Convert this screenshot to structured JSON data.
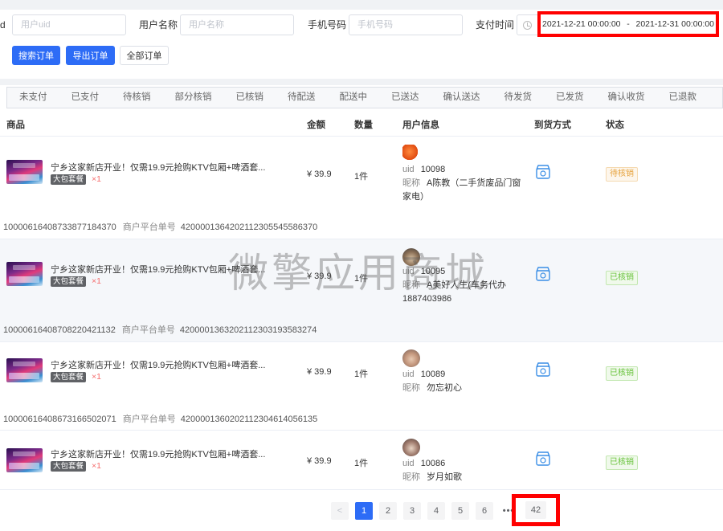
{
  "filters": {
    "uid": {
      "label": "d",
      "placeholder": "用户uid"
    },
    "username": {
      "label": "用户名称",
      "placeholder": "用户名称"
    },
    "phone": {
      "label": "手机号码",
      "placeholder": "手机号码"
    },
    "paytime": {
      "label": "支付时间",
      "start": "2021-12-21 00:00:00",
      "separator": "-",
      "end": "2021-12-31 00:00:00"
    }
  },
  "buttons": {
    "search": "搜索订单",
    "export": "导出订单",
    "all": "全部订单"
  },
  "tabs": [
    "未支付",
    "已支付",
    "待核销",
    "部分核销",
    "已核销",
    "待配送",
    "配送中",
    "已送达",
    "确认送达",
    "待发货",
    "已发货",
    "确认收货",
    "已退款"
  ],
  "columns": {
    "product": "商品",
    "amount": "金额",
    "qty": "数量",
    "user": "用户信息",
    "delivery": "到货方式",
    "status": "状态"
  },
  "orders": [
    {
      "product": "宁乡这家新店开业！仅需19.9元抢购KTV包厢+啤酒套...",
      "tag": "大包套餐",
      "qty_mark": "×1",
      "amount": "¥ 39.9",
      "count": "1件",
      "uid_label": "uid",
      "uid": "10098",
      "nick_label": "昵称",
      "nickname": "A陈教（二手货废品门窗家电）",
      "status": "待核销",
      "order_no": "10000616408733877184370",
      "platform_label": "商户平台单号",
      "platform_no": "4200001364202112305545586370"
    },
    {
      "product": "宁乡这家新店开业！仅需19.9元抢购KTV包厢+啤酒套...",
      "tag": "大包套餐",
      "qty_mark": "×1",
      "amount": "¥ 39.9",
      "count": "1件",
      "uid_label": "uid",
      "uid": "10095",
      "nick_label": "昵称",
      "nickname": "A美好人生(车务代办1887403986",
      "status": "已核销",
      "order_no": "10000616408708220421132",
      "platform_label": "商户平台单号",
      "platform_no": "4200001363202112303193583274"
    },
    {
      "product": "宁乡这家新店开业！仅需19.9元抢购KTV包厢+啤酒套...",
      "tag": "大包套餐",
      "qty_mark": "×1",
      "amount": "¥ 39.9",
      "count": "1件",
      "uid_label": "uid",
      "uid": "10089",
      "nick_label": "昵称",
      "nickname": "勿忘初心",
      "status": "已核销",
      "order_no": "10000616408673166502071",
      "platform_label": "商户平台单号",
      "platform_no": "4200001360202112304614056135"
    },
    {
      "product": "宁乡这家新店开业！仅需19.9元抢购KTV包厢+啤酒套...",
      "tag": "大包套餐",
      "qty_mark": "×1",
      "amount": "¥ 39.9",
      "count": "1件",
      "uid_label": "uid",
      "uid": "10086",
      "nick_label": "昵称",
      "nickname": "岁月如歌",
      "status": "已核销"
    }
  ],
  "pagination": {
    "prev": "<",
    "pages": [
      "1",
      "2",
      "3",
      "4",
      "5",
      "6"
    ],
    "more": "•••",
    "last": "42",
    "current": "1"
  },
  "watermark": "微擎应用商城",
  "colors": {
    "primary": "#2d6cf6",
    "highlight": "#ff0000",
    "pending": "#e6a23c",
    "done": "#67c23a"
  }
}
